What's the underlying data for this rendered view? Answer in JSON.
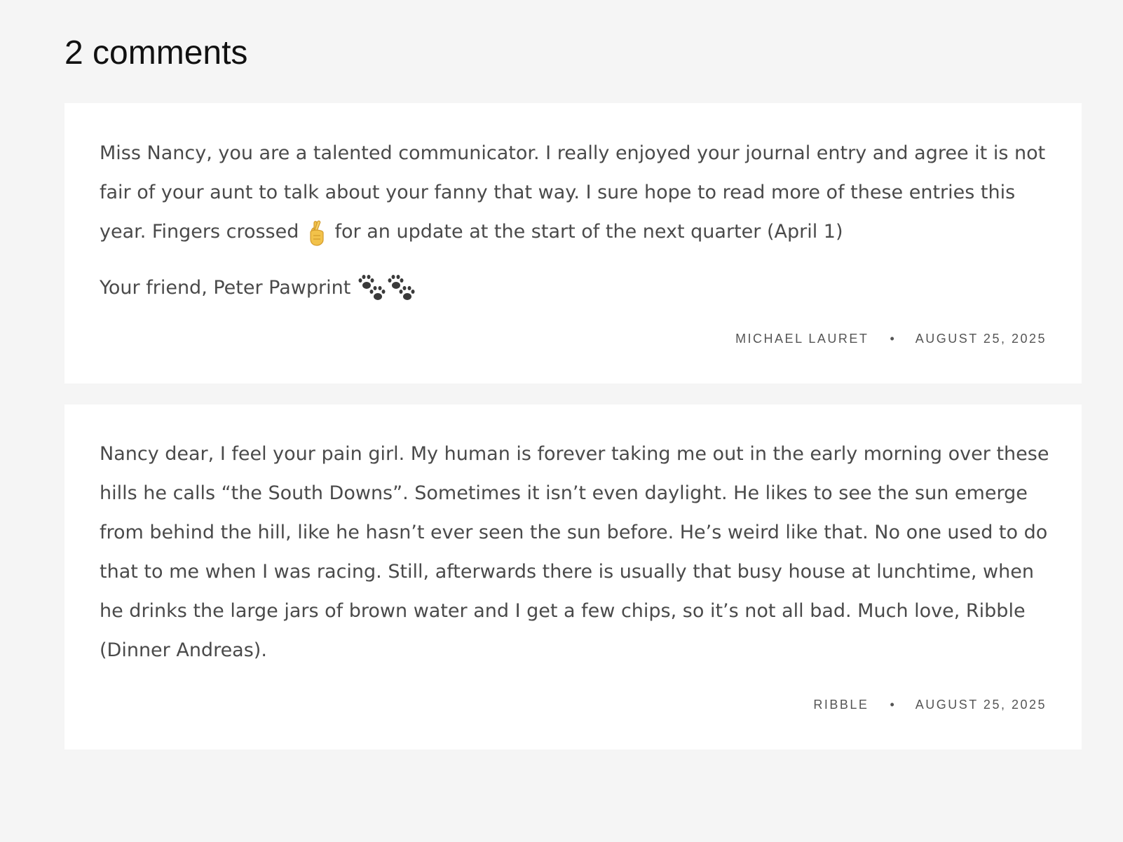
{
  "heading": "2 comments",
  "comments": [
    {
      "text_before_emoji": "Miss Nancy, you are a talented communicator. I really enjoyed your journal entry and agree it is not fair of your aunt to talk about your fanny that way. I sure hope to read more of these entries this year. Fingers crossed ",
      "emoji_1": "crossed-fingers-icon",
      "text_after_emoji": " for an update at the start of the next quarter (April 1)",
      "signature": "Your friend, Peter Pawprint ",
      "signature_emoji": "paw-prints-icon",
      "author": "MICHAEL LAURET",
      "separator": "•",
      "date": "AUGUST 25, 2025"
    },
    {
      "text": "Nancy dear, I feel your pain girl. My human is forever taking me out in the early morning over these hills he calls “the South Downs”. Sometimes it isn’t even daylight. He likes to see the sun emerge from behind the hill, like he hasn’t ever seen the sun before. He’s weird like that. No one used to do that to me when I was racing. Still, afterwards there is usually that busy house at lunchtime, when he drinks the large jars of brown water and I get a few chips, so it’s not all bad. Much love, Ribble (Dinner Andreas).",
      "author": "RIBBLE",
      "separator": "•",
      "date": "AUGUST 25, 2025"
    }
  ],
  "colors": {
    "page_background": "#f5f5f5",
    "card_background": "#ffffff",
    "heading_text": "#111111",
    "body_text": "#4a4a4a",
    "meta_text": "#555555",
    "emoji_yellow": "#f2c24a"
  }
}
